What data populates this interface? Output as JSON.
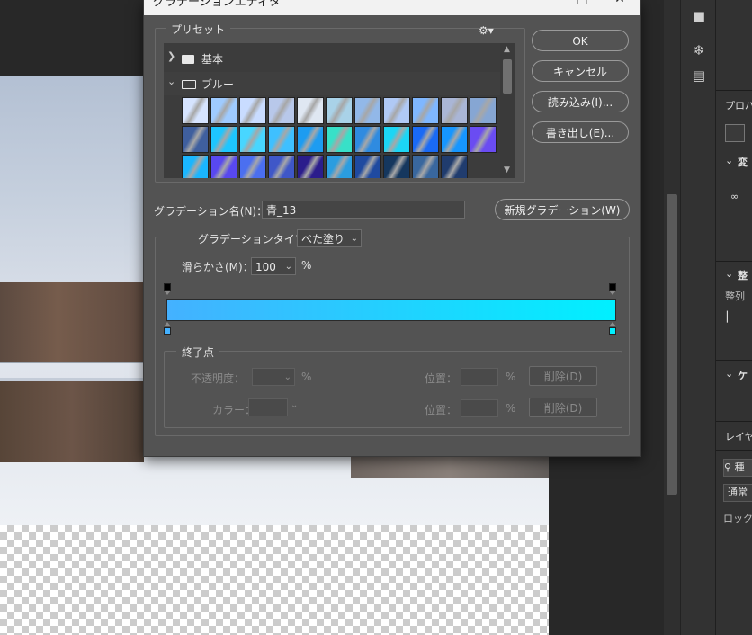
{
  "dialog": {
    "title": "グラデーションエディタ",
    "preset_section": {
      "label": "プリセット",
      "gear_icon": "gear-icon",
      "folders": [
        {
          "label": "基本",
          "expanded": false
        },
        {
          "label": "ブルー",
          "expanded": true
        }
      ],
      "swatch_colors": [
        [
          "#d6e4ff",
          "#9fcbff",
          "#c9dcff",
          "#b8c8ea",
          "#dfe7f2",
          "#a9d2e8",
          "#92b8e8",
          "#b0c9f5",
          "#7fb7ff",
          "#aab6d6",
          "#86a6d3"
        ],
        [
          "#3f5f9e",
          "#1ec6ff",
          "#48d6ff",
          "#3fc0ff",
          "#1d9cf1",
          "#38e0c8",
          "#2f8be0",
          "#1cd6f5",
          "#1a6af5",
          "#1696ff",
          "#6a4cf2"
        ],
        [
          "#1ab6ff",
          "#5848f0",
          "#4b6ff0",
          "#3f57c8",
          "#2b1d8c",
          "#2b9de0",
          "#1f4aa0",
          "#15375e",
          "#39679e",
          "#203c6e"
        ]
      ]
    },
    "buttons": {
      "ok": "OK",
      "cancel": "キャンセル",
      "load": "読み込み(I)...",
      "save": "書き出し(E)...",
      "new_gradient": "新規グラデーション(W)"
    },
    "name_field": {
      "label": "グラデーション名(N)：",
      "value": "青_13"
    },
    "gradient_type": {
      "label": "グラデーションタイプ：",
      "selected": "べた塗り"
    },
    "smoothness": {
      "label": "滑らかさ(M)：",
      "value": "100",
      "unit": "%"
    },
    "gradient": {
      "color_start": "#44b1ff",
      "color_end": "#00f0ff"
    },
    "stops_section": {
      "label": "終了点",
      "opacity_label": "不透明度：",
      "opacity_unit": "%",
      "color_label": "カラー：",
      "location_label_1": "位置：",
      "location_unit_1": "%",
      "delete_button_1": "削除(D)",
      "location_label_2": "位置：",
      "location_unit_2": "%",
      "delete_button_2": "削除(D)"
    }
  },
  "properties_panel": {
    "tab": "プロパ",
    "section_1": "変",
    "section_2": "整",
    "align_label": "整列",
    "section_3": "ケ",
    "layers_tab": "レイヤー",
    "search_placeholder": "種",
    "blend_mode": "通常",
    "lock_label": "ロック："
  }
}
